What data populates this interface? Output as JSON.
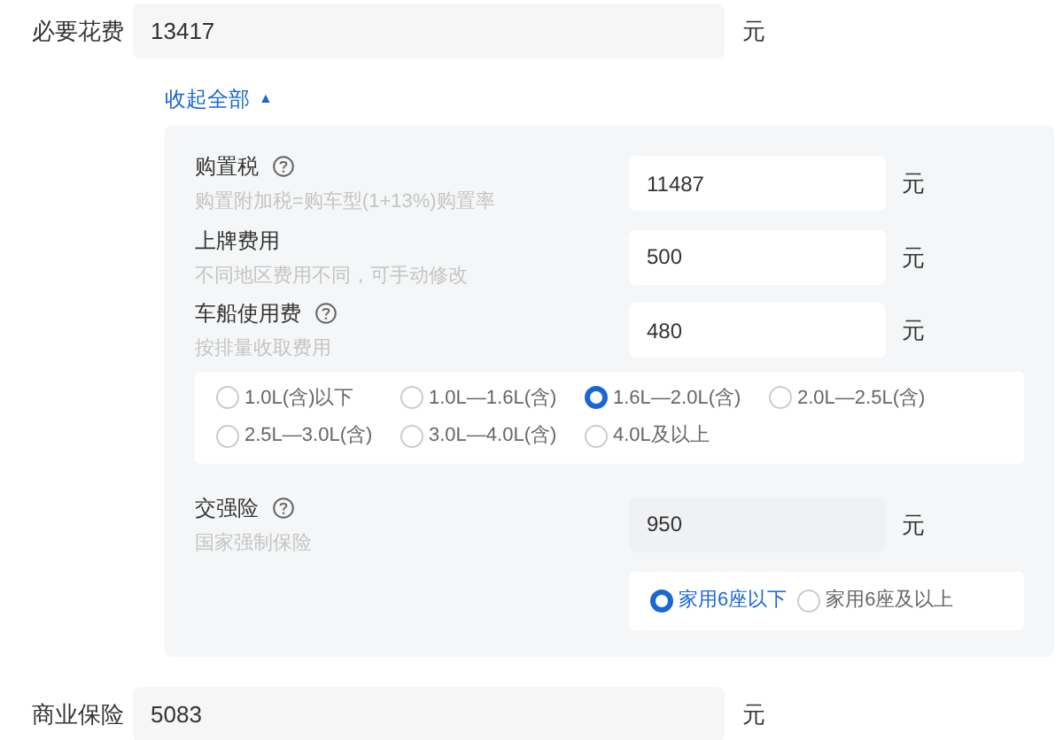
{
  "total": {
    "label": "必要花费",
    "value": "13417",
    "unit": "元"
  },
  "collapse_link": {
    "label": "收起全部",
    "icon": "▲"
  },
  "items": [
    {
      "label": "购置税",
      "help": true,
      "hint": "购置附加税=购车型(1+13%)购置率",
      "value": "11487",
      "unit": "元",
      "disabled": false
    },
    {
      "label": "上牌费用",
      "help": false,
      "hint": "不同地区费用不同，可手动修改",
      "value": "500",
      "unit": "元",
      "disabled": false
    },
    {
      "label": "车船使用费",
      "help": true,
      "hint": "按排量收取费用",
      "value": "480",
      "unit": "元",
      "disabled": false,
      "options": [
        {
          "label": "1.0L(含)以下",
          "selected": false
        },
        {
          "label": "1.0L—1.6L(含)",
          "selected": false
        },
        {
          "label": "1.6L—2.0L(含)",
          "selected": true
        },
        {
          "label": "2.0L—2.5L(含)",
          "selected": false
        },
        {
          "label": "2.5L—3.0L(含)",
          "selected": false
        },
        {
          "label": "3.0L—4.0L(含)",
          "selected": false
        },
        {
          "label": "4.0L及以上",
          "selected": false
        }
      ]
    },
    {
      "label": "交强险",
      "help": true,
      "hint": "国家强制保险",
      "value": "950",
      "unit": "元",
      "disabled": true,
      "options": [
        {
          "label": "家用6座以下",
          "selected": true
        },
        {
          "label": "家用6座及以上",
          "selected": false
        }
      ]
    }
  ],
  "commercial": {
    "label": "商业保险",
    "value": "5083",
    "unit": "元"
  }
}
